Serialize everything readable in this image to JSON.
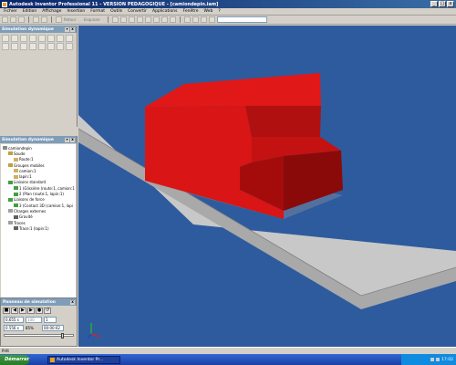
{
  "window": {
    "title": "Autodesk Inventor Professional 11 - VERSION PEDAGOGIQUE - [camiondepin.iam]",
    "buttons": [
      "_",
      "□",
      "x"
    ]
  },
  "menu": [
    "Fichier",
    "Edition",
    "Affichage",
    "Insertion",
    "Format",
    "Outils",
    "Convertir",
    "Applications",
    "Fenêtre",
    "Web",
    "?"
  ],
  "toolbar": {
    "retour_label": "Retour",
    "sketch_label": "Esquisse",
    "combo_value": ""
  },
  "panel_top": {
    "title": "Simulation dynamique"
  },
  "browser": {
    "title": "Simulation dynamique",
    "items": [
      {
        "level": 0,
        "label": "camiondepin",
        "color": "#888888"
      },
      {
        "level": 1,
        "label": "Soude",
        "color": "#c0a040"
      },
      {
        "level": 2,
        "label": "Route:1",
        "color": "#d0b060"
      },
      {
        "level": 1,
        "label": "Groupes mobiles",
        "color": "#c0a040"
      },
      {
        "level": 2,
        "label": "camion:1",
        "color": "#d0b060"
      },
      {
        "level": 2,
        "label": "lapin:1",
        "color": "#d0b060"
      },
      {
        "level": 1,
        "label": "Liaisons standard",
        "color": "#40a040"
      },
      {
        "level": 2,
        "label": "1 (Glissière (route:1, camion:1",
        "color": "#40a040"
      },
      {
        "level": 2,
        "label": "2 (Plan (route:1, lapin:1)",
        "color": "#40a040"
      },
      {
        "level": 1,
        "label": "Liaisons de force",
        "color": "#40a040"
      },
      {
        "level": 2,
        "label": "3 (Contact 3D (camion:1, lapi",
        "color": "#40a040"
      },
      {
        "level": 1,
        "label": "Charges externes",
        "color": "#a0a0a0"
      },
      {
        "level": 2,
        "label": "Gravité",
        "color": "#606060"
      },
      {
        "level": 1,
        "label": "Traces",
        "color": "#a0a0a0"
      },
      {
        "level": 2,
        "label": "Trace:1 (lapin:1)",
        "color": "#606060"
      }
    ]
  },
  "sim_panel": {
    "title": "Panneau de simulation",
    "end_time": "0,655 s",
    "images": "100",
    "filter": "1",
    "current_time": "0.556 s",
    "percent": "85%",
    "elapsed": "00:00:02",
    "progress": 0.85
  },
  "status": {
    "text": "Prêt"
  },
  "taskbar": {
    "start": "Démarrer",
    "task": "Autodesk Inventor Pr...",
    "clock": "17:02"
  },
  "colors": {
    "viewport_bg": "#2e5b9e",
    "road_top": "#c8c8c8",
    "road_front": "#a9a9a9",
    "truck_light": "#d91515",
    "truck_dark": "#a40c0c",
    "truck_shadow": "#8a0a0a"
  }
}
